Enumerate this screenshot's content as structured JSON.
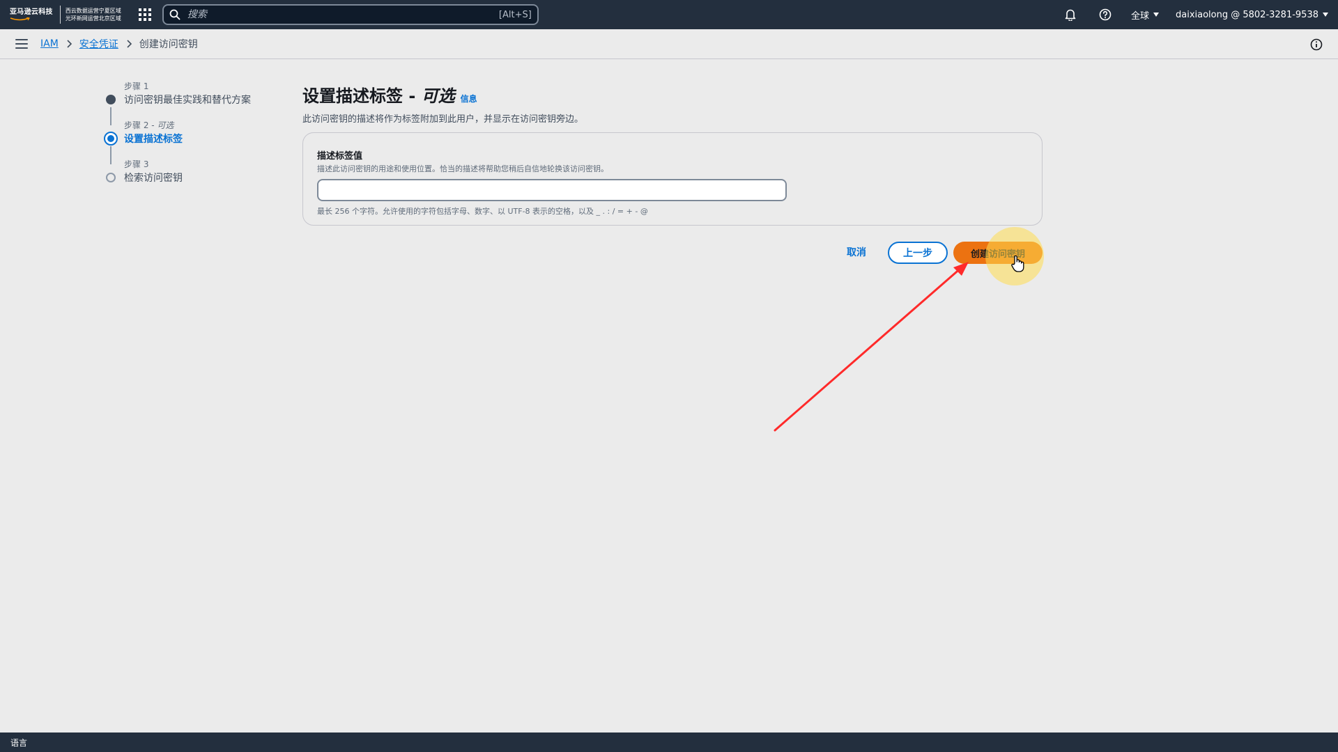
{
  "topbar": {
    "logo": {
      "text": "亚马逊云科技",
      "region_line1": "西云数据运营宁夏区域",
      "region_line2": "光环新网运营北京区域"
    },
    "search": {
      "placeholder": "搜索",
      "shortcut": "[Alt+S]"
    },
    "region_menu": "全球",
    "account_menu": "daixiaolong @ 5802-3281-9538"
  },
  "breadcrumb": {
    "items": [
      {
        "label": "IAM"
      },
      {
        "label": "安全凭证"
      },
      {
        "label": "创建访问密钥"
      }
    ]
  },
  "wizard": {
    "steps": [
      {
        "label": "步骤 1",
        "optional": "",
        "title": "访问密钥最佳实践和替代方案",
        "state": "done"
      },
      {
        "label": "步骤 2 - ",
        "optional": "可选",
        "title": "设置描述标签",
        "state": "active"
      },
      {
        "label": "步骤 3",
        "optional": "",
        "title": "检索访问密钥",
        "state": "todo"
      }
    ]
  },
  "main": {
    "title": "设置描述标签 - ",
    "title_optional": "可选",
    "info_link": "信息",
    "description": "此访问密钥的描述将作为标签附加到此用户，并显示在访问密钥旁边。",
    "field": {
      "label": "描述标签值",
      "description": "描述此访问密钥的用途和使用位置。恰当的描述将帮助您稍后自信地轮换该访问密钥。",
      "value": "",
      "hint": "最长 256 个字符。允许使用的字符包括字母、数字、以 UTF-8 表示的空格，以及 _ . : / = + - @"
    },
    "actions": {
      "cancel": "取消",
      "previous": "上一步",
      "create": "创建访问密钥"
    }
  },
  "footer": {
    "language": "语言"
  },
  "colors": {
    "topbar": "#232f3e",
    "link": "#0972d3",
    "primary_button": "#ec7211",
    "annotation_arrow": "#ff2a2a"
  }
}
